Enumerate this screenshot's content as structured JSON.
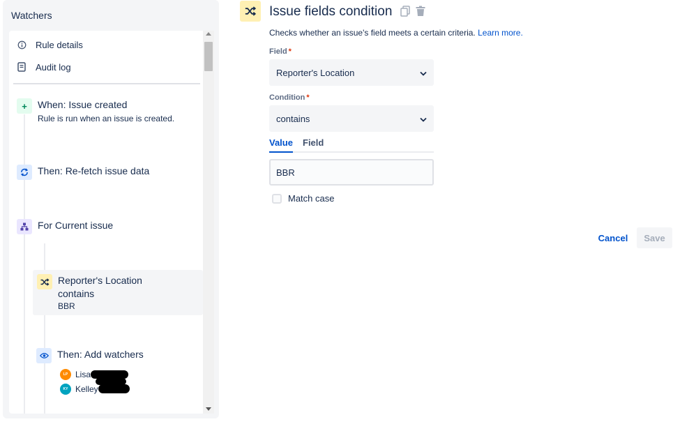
{
  "sidebar": {
    "title": "Watchers",
    "menu": [
      {
        "label": "Rule details",
        "icon": "info-icon"
      },
      {
        "label": "Audit log",
        "icon": "document-icon"
      }
    ],
    "steps": {
      "trigger": {
        "title": "When: Issue created",
        "description": "Rule is run when an issue is created.",
        "icon": "plus-icon",
        "color": "#e3fcef"
      },
      "refetch": {
        "title": "Then: Re-fetch issue data",
        "icon": "refresh-icon",
        "color": "#deebff"
      },
      "branch": {
        "title": "For Current issue",
        "icon": "branch-icon",
        "color": "#eae6ff"
      },
      "condition": {
        "line1": "Reporter's Location",
        "line2": "contains",
        "line3": "BBR",
        "icon": "shuffle-icon",
        "color": "#fff0b3"
      },
      "watchers": {
        "title": "Then: Add watchers",
        "icon": "eye-icon",
        "color": "#deebff",
        "people": [
          {
            "initials": "LP",
            "name": "Lisa",
            "avatar_color": "#ff8b00"
          },
          {
            "initials": "KY",
            "name": "Kelley",
            "avatar_color": "#00a3bf"
          }
        ]
      }
    }
  },
  "editor": {
    "title": "Issue fields condition",
    "description": "Checks whether an issue's field meets a certain criteria.",
    "learn_more": "Learn more.",
    "field_label": "Field",
    "field_required": "*",
    "field_value": "Reporter's Location",
    "condition_label": "Condition",
    "condition_required": "*",
    "condition_value": "contains",
    "tabs": {
      "value": "Value",
      "field": "Field"
    },
    "input_value": "BBR",
    "match_case_label": "Match case",
    "cancel_label": "Cancel",
    "save_label": "Save"
  }
}
